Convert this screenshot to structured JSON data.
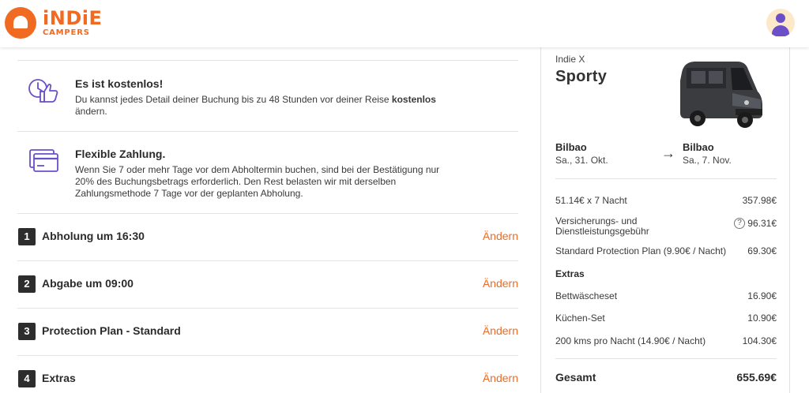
{
  "header": {
    "logo_main": "iNDiE",
    "logo_sub": "CAMPERS",
    "brand_color": "#f06a22",
    "avatar_icon": "user-avatar-icon"
  },
  "info": [
    {
      "icon": "calendar-thumbs-up-icon",
      "title": "Es ist kostenlos!",
      "text_before": "Du kannst jedes Detail deiner Buchung bis zu 48 Stunden vor deiner Reise ",
      "text_bold": "kostenlos",
      "text_after": " ändern."
    },
    {
      "icon": "payment-card-icon",
      "title": "Flexible Zahlung.",
      "text": "Wenn Sie 7 oder mehr Tage vor dem Abholtermin buchen, sind bei der Bestätigung nur 20% des Buchungsbetrags erforderlich. Den Rest belasten wir mit derselben Zahlungsmethode 7 Tage vor der geplanten Abholung."
    }
  ],
  "steps": [
    {
      "num": "1",
      "label": "Abholung um 16:30",
      "action": "Ändern"
    },
    {
      "num": "2",
      "label": "Abgabe um 09:00",
      "action": "Ändern"
    },
    {
      "num": "3",
      "label": "Protection Plan - Standard",
      "action": "Ändern"
    },
    {
      "num": "4",
      "label": "Extras",
      "action": "Ändern"
    }
  ],
  "summary": {
    "subtitle": "Indie X",
    "title": "Sporty",
    "pickup_city": "Bilbao",
    "pickup_date": "Sa., 31. Okt.",
    "dropoff_city": "Bilbao",
    "dropoff_date": "Sa., 7. Nov.",
    "arrow": "→",
    "lines": [
      {
        "label": "51.14€ x 7 Nacht",
        "value": "357.98€"
      },
      {
        "label": "Versicherungs- und Dienstleistungsgebühr",
        "value": "96.31€",
        "help": "?"
      },
      {
        "label": "Standard Protection Plan (9.90€ / Nacht)",
        "value": "69.30€"
      }
    ],
    "extras_heading": "Extras",
    "extras": [
      {
        "label": "Bettwäscheset",
        "value": "16.90€"
      },
      {
        "label": "Küchen-Set",
        "value": "10.90€"
      },
      {
        "label": "200 kms pro Nacht (14.90€ / Nacht)",
        "value": "104.30€"
      }
    ],
    "total_label": "Gesamt",
    "total_value": "655.69€"
  }
}
